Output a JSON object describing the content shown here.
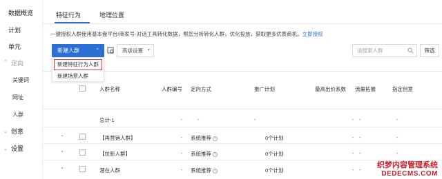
{
  "sidebar": {
    "items": [
      {
        "label": "数据概览"
      },
      {
        "label": "计划"
      },
      {
        "label": "单元"
      },
      {
        "label": "定向"
      },
      {
        "label": "关键词"
      },
      {
        "label": "网址"
      },
      {
        "label": "人群"
      },
      {
        "label": "创意"
      },
      {
        "label": "设置"
      }
    ]
  },
  "tabs": [
    {
      "label": "特征行为"
    },
    {
      "label": "地理位置"
    }
  ],
  "description": {
    "text": "一键授权人群使用基本盘平台/商家号-对话工具转化数据，帮您分析转化人群，优化投放，获取更多优质商机。",
    "link": "立即授权"
  },
  "toolbar": {
    "new_button": "新建人群",
    "advanced_button": "高级设置",
    "search_placeholder": "请搜索人群",
    "filter_button": "筛选"
  },
  "dropdown": {
    "items": [
      {
        "label": "新建特征行为人群"
      },
      {
        "label": "新建场景人群"
      }
    ]
  },
  "table": {
    "headers": [
      "人群名称",
      "人群编号",
      "定向方式",
      "推广计划",
      "最高出价系数",
      "流量拓展",
      "指定创意"
    ],
    "total_row": {
      "name": "总计-1",
      "values": [
        "-",
        "-",
        "-",
        "-",
        "-",
        "-"
      ]
    },
    "rows": [
      {
        "name": "【再营销人群】",
        "id": "-",
        "method": "系统推荐",
        "plan": "0个计划",
        "bid": "-",
        "traffic": "-",
        "creative": "-"
      },
      {
        "name": "【拉新人群】",
        "id": "-",
        "method": "系统推荐",
        "plan": "0个计划",
        "bid": "-",
        "traffic": "-",
        "creative": "-"
      },
      {
        "name": "潜在人群",
        "id": "-",
        "method": "系统推荐",
        "plan": "0个计划",
        "bid": "-",
        "traffic": "-",
        "creative": "-"
      }
    ]
  },
  "watermark": {
    "line1": "织梦内容管理系统",
    "line2": "DEDECMS.COM"
  },
  "colors": {
    "accent": "#2b6fd6",
    "highlight_border": "#d63b3b",
    "watermark": "#c8202a"
  }
}
